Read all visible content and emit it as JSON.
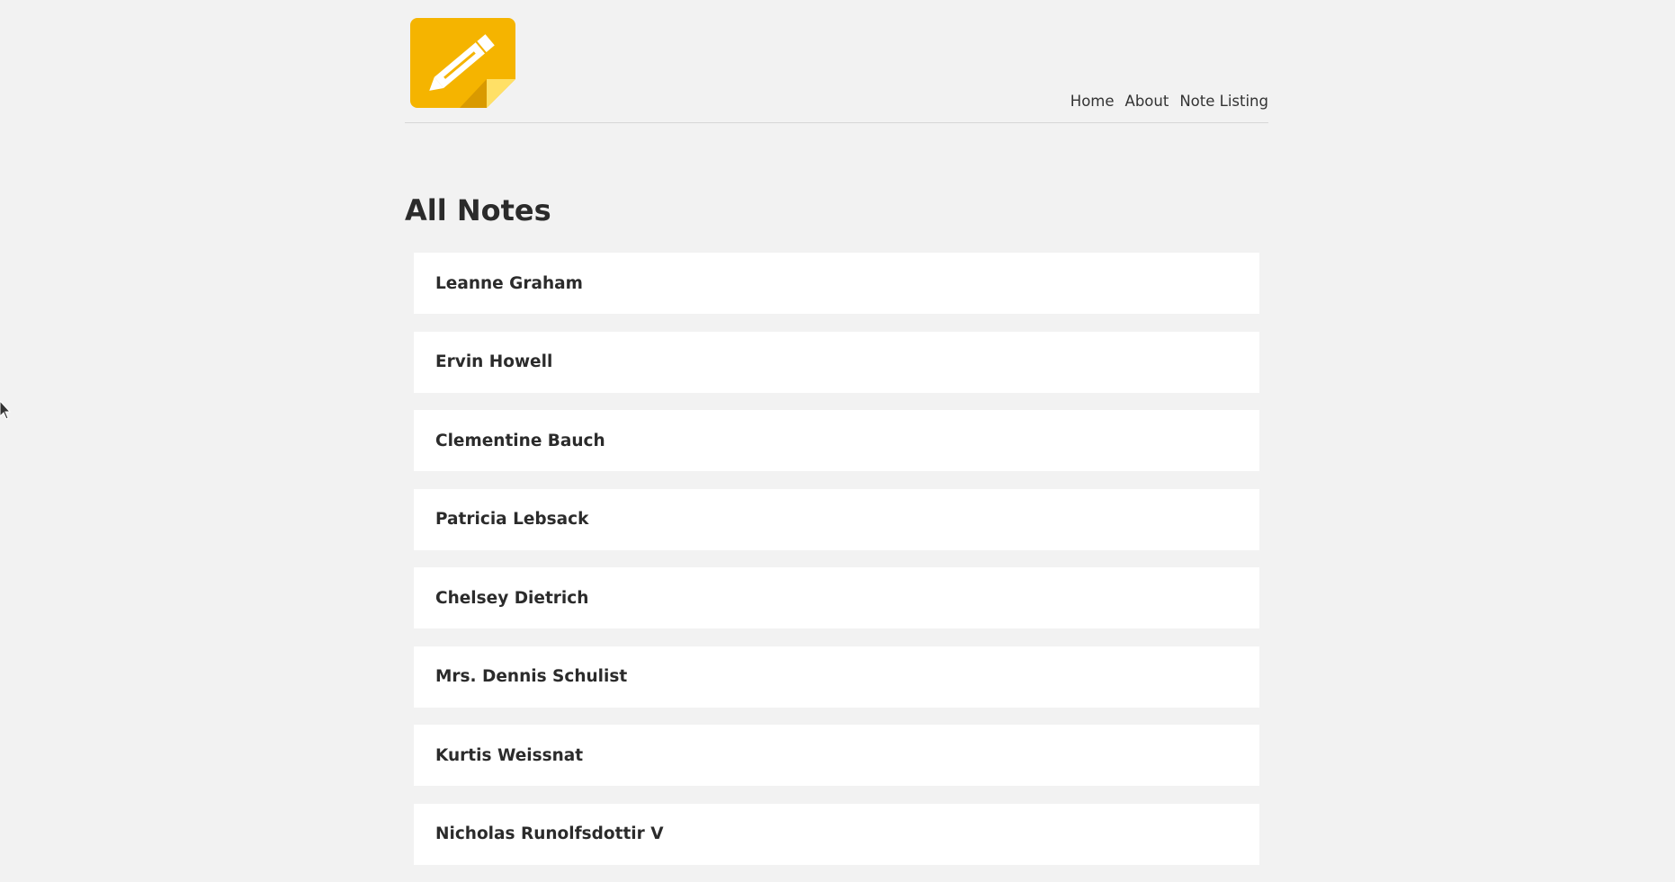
{
  "nav": {
    "items": [
      {
        "label": "Home"
      },
      {
        "label": "About"
      },
      {
        "label": "Note Listing"
      }
    ]
  },
  "main": {
    "title": "All Notes",
    "notes": [
      {
        "name": "Leanne Graham"
      },
      {
        "name": "Ervin Howell"
      },
      {
        "name": "Clementine Bauch"
      },
      {
        "name": "Patricia Lebsack"
      },
      {
        "name": "Chelsey Dietrich"
      },
      {
        "name": "Mrs. Dennis Schulist"
      },
      {
        "name": "Kurtis Weissnat"
      },
      {
        "name": "Nicholas Runolfsdottir V"
      }
    ]
  },
  "colors": {
    "background": "#f2f2f2",
    "card": "#ffffff",
    "logo_yellow": "#f5b400",
    "logo_fold": "#ffe066"
  },
  "icons": {
    "logo": "note-pencil-icon",
    "cursor": "mouse-pointer-icon"
  }
}
